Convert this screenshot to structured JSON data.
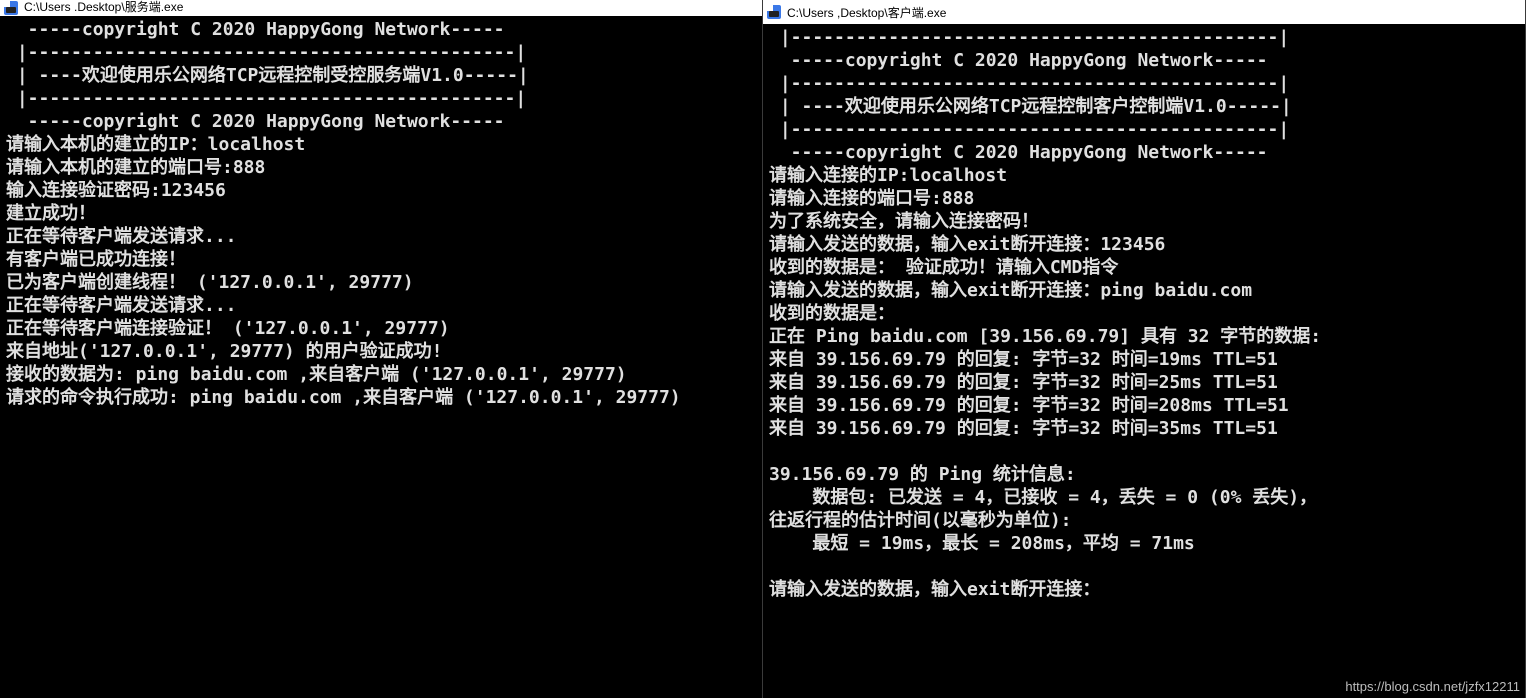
{
  "left": {
    "title": "C:\\Users            .Desktop\\服务端.exe",
    "lines": [
      "  -----copyright C 2020 HappyGong Network-----",
      " |---------------------------------------------|",
      " | ----欢迎使用乐公网络TCP远程控制受控服务端V1.0-----|",
      " |---------------------------------------------|",
      "  -----copyright C 2020 HappyGong Network-----",
      "请输入本机的建立的IP：localhost",
      "请输入本机的建立的端口号:888",
      "输入连接验证密码:123456",
      "建立成功！",
      "正在等待客户端发送请求...",
      "有客户端已成功连接！",
      "已为客户端创建线程！ ('127.0.0.1', 29777)",
      "正在等待客户端发送请求...",
      "正在等待客户端连接验证！ ('127.0.0.1', 29777)",
      "来自地址('127.0.0.1', 29777) 的用户验证成功!",
      "接收的数据为: ping baidu.com ,来自客户端 ('127.0.0.1', 29777)",
      "请求的命令执行成功: ping baidu.com ,来自客户端 ('127.0.0.1', 29777)"
    ]
  },
  "right": {
    "title": "C:\\Users           ,Desktop\\客户端.exe",
    "lines": [
      " |---------------------------------------------|",
      "  -----copyright C 2020 HappyGong Network-----",
      " |---------------------------------------------|",
      " | ----欢迎使用乐公网络TCP远程控制客户控制端V1.0-----|",
      " |---------------------------------------------|",
      "  -----copyright C 2020 HappyGong Network-----",
      "请输入连接的IP:localhost",
      "请输入连接的端口号:888",
      "为了系统安全，请输入连接密码！",
      "请输入发送的数据，输入exit断开连接：123456",
      "收到的数据是： 验证成功！请输入CMD指令",
      "请输入发送的数据，输入exit断开连接：ping baidu.com",
      "收到的数据是：",
      "正在 Ping baidu.com [39.156.69.79] 具有 32 字节的数据:",
      "来自 39.156.69.79 的回复: 字节=32 时间=19ms TTL=51",
      "来自 39.156.69.79 的回复: 字节=32 时间=25ms TTL=51",
      "来自 39.156.69.79 的回复: 字节=32 时间=208ms TTL=51",
      "来自 39.156.69.79 的回复: 字节=32 时间=35ms TTL=51",
      "",
      "39.156.69.79 的 Ping 统计信息:",
      "    数据包: 已发送 = 4，已接收 = 4，丢失 = 0 (0% 丢失)，",
      "往返行程的估计时间(以毫秒为单位):",
      "    最短 = 19ms，最长 = 208ms，平均 = 71ms",
      "",
      "请输入发送的数据，输入exit断开连接："
    ]
  },
  "watermark": "https://blog.csdn.net/jzfx12211"
}
